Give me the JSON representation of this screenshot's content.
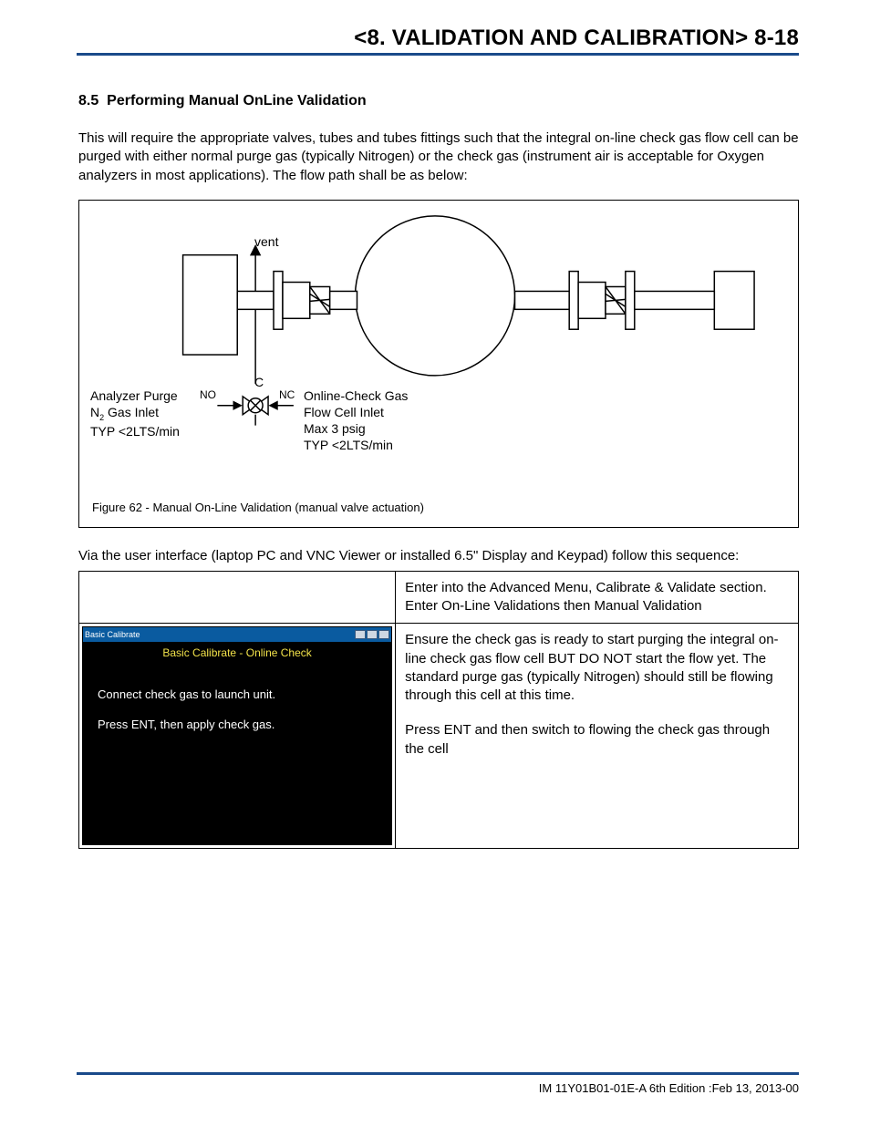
{
  "header": {
    "running": "<8. VALIDATION AND CALIBRATION>  8-18"
  },
  "section": {
    "number": "8.5",
    "title": "Performing Manual OnLine Validation",
    "intro": "This will require the appropriate valves, tubes and tubes fittings such that the integral on-line check gas flow cell can be purged with either normal purge gas (typically Nitrogen) or the check gas (instrument air is acceptable for Oxygen analyzers in most applications). The flow path shall be as below:"
  },
  "figure": {
    "vent": "vent",
    "c": "C",
    "no": "NO",
    "nc": "NC",
    "left_line1": "Analyzer Purge",
    "left_line2a": "N",
    "left_line2b": " Gas Inlet",
    "left_line3": "TYP <2LTS/min",
    "right_line1": "Online-Check Gas",
    "right_line2": "Flow Cell Inlet",
    "right_line3": "Max 3 psig",
    "right_line4": "TYP <2LTS/min",
    "caption": "Figure 62 - Manual On-Line Validation (manual valve actuation)"
  },
  "sequence": {
    "intro": "Via the user interface (laptop PC and VNC Viewer or installed 6.5\" Display and Keypad) follow this sequence:",
    "rows": [
      {
        "left": "",
        "right": "Enter into the Advanced Menu, Calibrate & Validate section. Enter On-Line Validations then Manual Validation"
      },
      {
        "screen": {
          "titlebar": "Basic Calibrate",
          "header": "Basic Calibrate - Online Check",
          "line1": "Connect check gas to launch unit.",
          "line2": "Press ENT, then apply check gas."
        },
        "right_p1": "Ensure the check gas is ready to start purging the integral on-line check gas flow cell BUT DO NOT start the flow yet. The standard purge gas (typically Nitrogen) should still be flowing through this cell at this time.",
        "right_p2": "Press ENT and then switch to flowing the check gas through the cell"
      }
    ]
  },
  "footer": {
    "text": "IM 11Y01B01-01E-A    6th Edition :Feb 13, 2013-00"
  }
}
